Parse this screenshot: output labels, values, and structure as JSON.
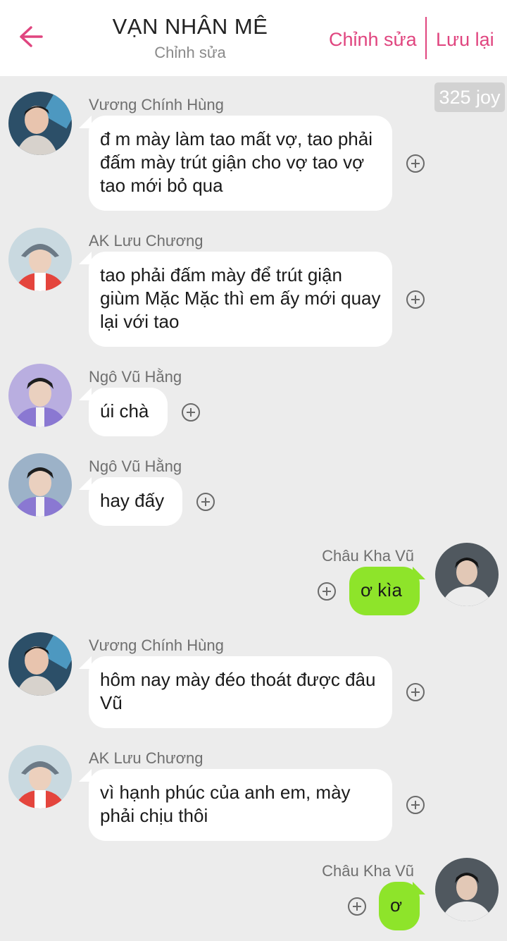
{
  "header": {
    "title": "VẠN NHÂN MÊ",
    "subtitle": "Chỉnh sửa",
    "edit_label": "Chỉnh sửa",
    "save_label": "Lưu lại",
    "accent_color": "#e0457f",
    "back_icon": "arrow-left-icon"
  },
  "joy_badge": "325 joy",
  "messages": [
    {
      "sender": "Vương Chính Hùng",
      "text": "đ m mày làm tao mất vợ, tao phải đấm mày trút giận cho vợ tao vợ tao mới bỏ qua",
      "side": "in"
    },
    {
      "sender": "AK Lưu Chương",
      "text": "tao phải đấm mày để trút giận giùm Mặc Mặc thì em ấy mới quay lại với tao",
      "side": "in"
    },
    {
      "sender": "Ngô Vũ Hằng",
      "text": "úi chà",
      "side": "in"
    },
    {
      "sender": "Ngô Vũ Hằng",
      "text": "hay đấy",
      "side": "in"
    },
    {
      "sender": "Châu Kha Vũ",
      "text": "ơ kìa",
      "side": "out"
    },
    {
      "sender": "Vương Chính Hùng",
      "text": "hôm nay mày đéo thoát được đâu Vũ",
      "side": "in"
    },
    {
      "sender": "AK Lưu Chương",
      "text": "vì hạnh phúc của anh em, mày phải chịu thôi",
      "side": "in"
    },
    {
      "sender": "Châu Kha Vũ",
      "text": "ơ",
      "side": "out"
    }
  ],
  "colors": {
    "background": "#ececec",
    "incoming_bubble": "#ffffff",
    "outgoing_bubble": "#8ee42a"
  }
}
